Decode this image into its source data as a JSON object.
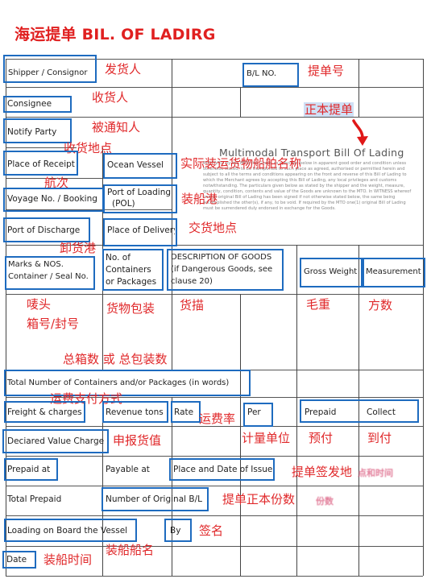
{
  "title": "海运提单 BIL. OF LADIRG",
  "fields": {
    "shipper": "Shipper / Consignor",
    "bl_no": "B/L NO.",
    "consignee": "Consignee",
    "notify_party": "Notify Party",
    "place_of_receipt": "Place of Receipt",
    "ocean_vessel": "Ocean Vessel",
    "voyage_no": "Voyage No. / Booking",
    "port_of_loading": "Port of Loading",
    "port_of_loading_sub": "(POL)",
    "port_of_discharge": "Port of Discharge",
    "place_of_delivery": "Place of Delivery",
    "marks_line1": "Marks & NOS.",
    "marks_line2": "Container / Seal No.",
    "containers_line1": "No. of",
    "containers_line2": "Containers",
    "containers_line3": "or Packages",
    "description_line1": "DESCRIPTION OF GOODS",
    "description_line2": "(if Dangerous Goods, see",
    "description_line3": "clause 20)",
    "gross_weight": "Gross Weight",
    "measurement": "Measurement",
    "total_number": "Total Number of Containers and/or Packages (in words)",
    "freight_charges": "Freight & charges",
    "revenue_tons": "Revenue tons",
    "rate": "Rate",
    "per": "Per",
    "prepaid": "Prepaid",
    "collect": "Collect",
    "declared_value": "Deciared Value Charge",
    "prepaid_at": "Prepaid at",
    "payable_at": "Payable at",
    "place_date_issue": "Place and Date of Issue",
    "total_prepaid": "Total Prepaid",
    "number_original_bl": "Number of Original B/L",
    "loading_on_board": "Loading on Board the Vessel",
    "by": "By",
    "date": "Date"
  },
  "annotations": {
    "shipper": "发货人",
    "bl_no": "提单号",
    "consignee": "收货人",
    "original_bl": "正本提单",
    "notify_party": "被通知人",
    "place_of_receipt": "收货地点",
    "ocean_vessel": "实际装运货物船舶名称",
    "voyage": "航次",
    "port_of_loading": "装船港",
    "place_of_delivery": "交货地点",
    "port_of_discharge": "卸货港",
    "marks_line1": "唛头",
    "marks_line2": "箱号/封号",
    "packages": "货物包装",
    "description": "货描",
    "gross_weight": "毛重",
    "measurement": "方数",
    "total_number": "总箱数 或 总包装数",
    "freight_payment": "运费支付方式",
    "rate": "运费率",
    "declared_value": "申报货值",
    "per": "计量单位",
    "prepaid": "预付",
    "collect": "到付",
    "place_date_issue": "提单签发地",
    "number_original": "提单正本份数",
    "signature": "签名",
    "vessel_name": "装船船名",
    "loading_time": "装船时间"
  },
  "document": {
    "heading": "Multimodal Transport Bill Of Lading",
    "body": "RECEIVED by the MTO the Goods as specified below in apparent good order and condition unless otherwise stated, to be transported to such place as agreed, authorised or permitted herein and subject to all the terms and conditions appearing on the front and reverse of this Bill of Lading to which the Merchant agrees by accepting this Bill of Lading, any local privileges and customs notwithstanding. The particulars given below as stated by the shipper and the weight, measure, quantity, condition, contents and value of the Goods are unknown to the MTO. In WITNESS whereof one(1) original Bill of Lading has been signed if not otherwise stated below, the same being accomplished the other(s), if any, to be void. If required by the MTO one(1) original Bill of Lading must be surrendered duly endorsed in exchange for the Goods."
  },
  "stamps": {
    "issue_stamp": "点和时间",
    "count_stamp": "份数"
  },
  "colors": {
    "title_red": "#e02020",
    "annotation_red": "#e0282a",
    "box_blue": "#1e6bbf",
    "highlight_blue": "#cfe0f5"
  }
}
